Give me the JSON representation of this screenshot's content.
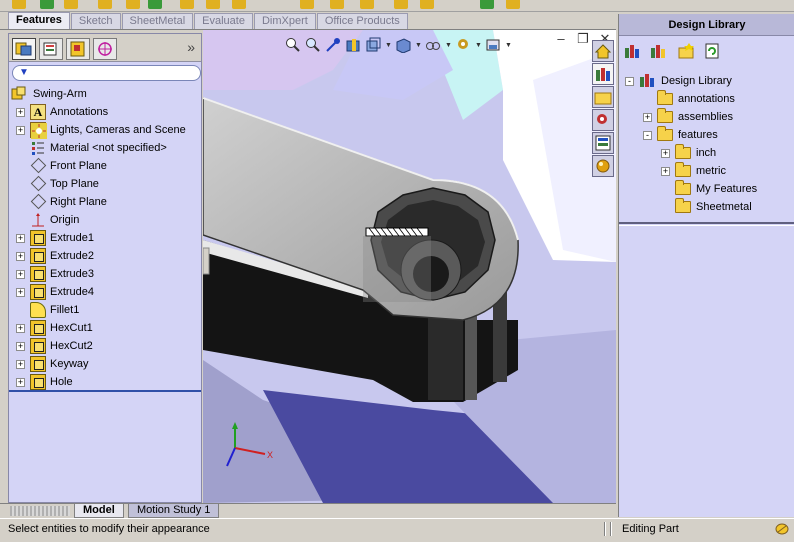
{
  "tabs": [
    {
      "label": "Features",
      "active": true
    },
    {
      "label": "Sketch",
      "active": false
    },
    {
      "label": "SheetMetal",
      "active": false
    },
    {
      "label": "Evaluate",
      "active": false
    },
    {
      "label": "DimXpert",
      "active": false
    },
    {
      "label": "Office Products",
      "active": false
    }
  ],
  "feature_tree": {
    "root": "Swing-Arm",
    "items": [
      {
        "label": "Annotations",
        "icon": "annotations-icon",
        "expandable": true
      },
      {
        "label": "Lights, Cameras and Scene",
        "icon": "lights-icon",
        "expandable": true
      },
      {
        "label": "Material <not specified>",
        "icon": "material-icon",
        "expandable": false
      },
      {
        "label": "Front Plane",
        "icon": "plane-icon",
        "expandable": false
      },
      {
        "label": "Top Plane",
        "icon": "plane-icon",
        "expandable": false
      },
      {
        "label": "Right Plane",
        "icon": "plane-icon",
        "expandable": false
      },
      {
        "label": "Origin",
        "icon": "origin-icon",
        "expandable": false
      },
      {
        "label": "Extrude1",
        "icon": "extrude-icon",
        "expandable": true
      },
      {
        "label": "Extrude2",
        "icon": "extrude-icon",
        "expandable": true
      },
      {
        "label": "Extrude3",
        "icon": "extrude-icon",
        "expandable": true
      },
      {
        "label": "Extrude4",
        "icon": "extrude-icon",
        "expandable": true
      },
      {
        "label": "Fillet1",
        "icon": "fillet-icon",
        "expandable": false
      },
      {
        "label": "HexCut1",
        "icon": "cut-icon",
        "expandable": true
      },
      {
        "label": "HexCut2",
        "icon": "cut-icon",
        "expandable": true
      },
      {
        "label": "Keyway",
        "icon": "cut-icon",
        "expandable": true
      },
      {
        "label": "Hole",
        "icon": "cut-icon",
        "expandable": true
      }
    ]
  },
  "design_library": {
    "title": "Design Library",
    "tree": [
      {
        "label": "Design Library",
        "level": 0,
        "expander": "-"
      },
      {
        "label": "annotations",
        "level": 1,
        "expander": ""
      },
      {
        "label": "assemblies",
        "level": 1,
        "expander": "+"
      },
      {
        "label": "features",
        "level": 1,
        "expander": "-"
      },
      {
        "label": "inch",
        "level": 2,
        "expander": "+"
      },
      {
        "label": "metric",
        "level": 2,
        "expander": "+"
      },
      {
        "label": "My Features",
        "level": 2,
        "expander": ""
      },
      {
        "label": "Sheetmetal",
        "level": 2,
        "expander": ""
      }
    ]
  },
  "bottom_tabs": [
    {
      "label": "Model",
      "active": true
    },
    {
      "label": "Motion Study 1",
      "active": false
    }
  ],
  "status": {
    "message": "Select entities to modify their appearance",
    "mode": "Editing Part"
  },
  "colors": {
    "panel_bg": "#d4d4f6",
    "viewport_bg": "#c8c8ee",
    "accent_blue": "#3050a8"
  }
}
